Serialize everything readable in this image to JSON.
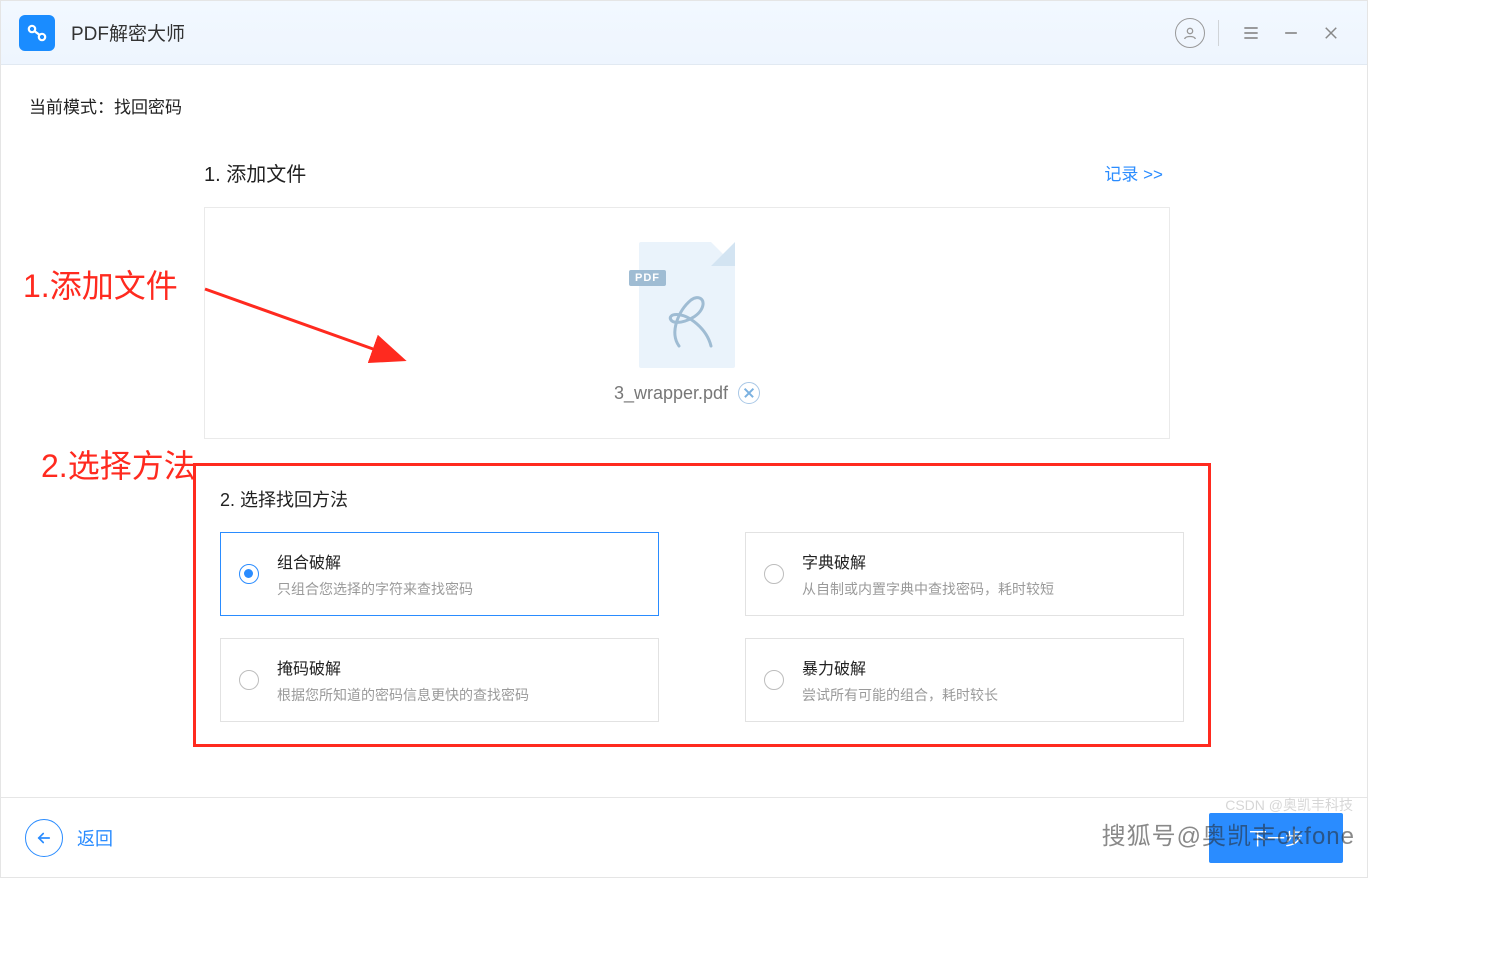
{
  "app": {
    "title": "PDF解密大师"
  },
  "mode": {
    "label": "当前模式：",
    "value": "找回密码"
  },
  "step1": {
    "title": "1. 添加文件",
    "record_link": "记录 >>",
    "pdf_badge": "PDF",
    "filename": "3_wrapper.pdf"
  },
  "step2": {
    "title": "2. 选择找回方法",
    "methods": [
      {
        "name": "组合破解",
        "desc": "只组合您选择的字符来查找密码",
        "selected": true
      },
      {
        "name": "字典破解",
        "desc": "从自制或内置字典中查找密码，耗时较短",
        "selected": false
      },
      {
        "name": "掩码破解",
        "desc": "根据您所知道的密码信息更快的查找密码",
        "selected": false
      },
      {
        "name": "暴力破解",
        "desc": "尝试所有可能的组合，耗时较长",
        "selected": false
      }
    ]
  },
  "footer": {
    "back": "返回",
    "next": "下一步"
  },
  "annotations": {
    "a1": "1.添加文件",
    "a2": "2.选择方法"
  },
  "watermark": {
    "primary": "搜狐号@奥凯丰okfone",
    "secondary": "CSDN @奥凯丰科技"
  }
}
